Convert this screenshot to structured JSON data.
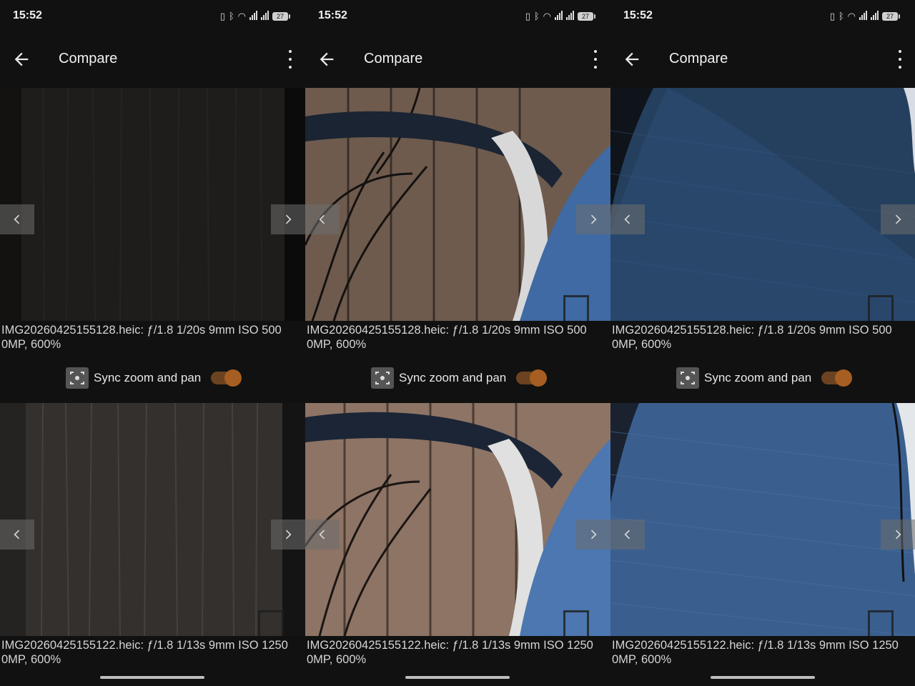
{
  "status_bar": {
    "time": "15:52",
    "network": "4G",
    "battery": "27"
  },
  "app_bar": {
    "title": "Compare"
  },
  "sync": {
    "label": "Sync zoom and pan",
    "enabled": true
  },
  "colors": {
    "accent": "#a65e22",
    "accent_track": "#6b4320",
    "background": "#111111"
  },
  "panels": [
    {
      "top_image": {
        "caption": "IMG20260425155128.heic: ƒ/1.8 1/20s 9mm ISO 500\n0MP, 600%",
        "scene": "dark-wood"
      },
      "bottom_image": {
        "caption": "IMG20260425155122.heic: ƒ/1.8 1/13s 9mm ISO 1250\n0MP, 600%",
        "scene": "dark-wood"
      }
    },
    {
      "top_image": {
        "caption": "IMG20260425155128.heic: ƒ/1.8 1/20s 9mm ISO 500\n0MP, 600%",
        "scene": "chair-wood"
      },
      "bottom_image": {
        "caption": "IMG20260425155122.heic: ƒ/1.8 1/13s 9mm ISO 1250\n0MP, 600%",
        "scene": "chair-wood"
      }
    },
    {
      "top_image": {
        "caption": "IMG20260425155128.heic: ƒ/1.8 1/20s 9mm ISO 500\n0MP, 600%",
        "scene": "blue-fabric"
      },
      "bottom_image": {
        "caption": "IMG20260425155122.heic: ƒ/1.8 1/13s 9mm ISO 1250\n0MP, 600%",
        "scene": "blue-fabric"
      }
    }
  ]
}
